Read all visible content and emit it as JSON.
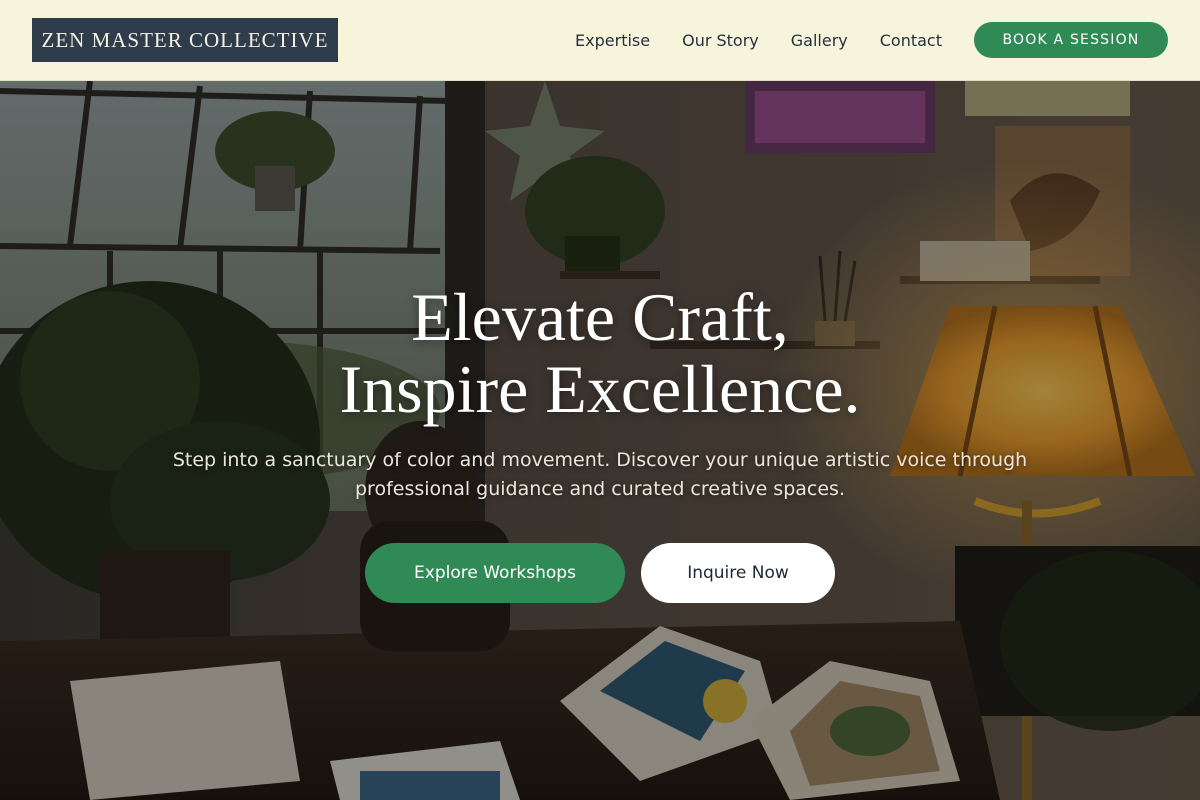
{
  "brand": {
    "name": "ZEN MASTER COLLECTIVE"
  },
  "nav": {
    "items": [
      {
        "label": "Expertise"
      },
      {
        "label": "Our Story"
      },
      {
        "label": "Gallery"
      },
      {
        "label": "Contact"
      }
    ],
    "cta_label": "BOOK A SESSION"
  },
  "hero": {
    "title_line1": "Elevate Craft,",
    "title_line2": "Inspire Excellence.",
    "subtitle": "Step into a sanctuary of color and movement. Discover your unique artistic voice through professional guidance and curated creative spaces.",
    "primary_button": "Explore Workshops",
    "secondary_button": "Inquire Now"
  },
  "colors": {
    "header_bg": "#f6f4db",
    "logo_bg": "#2f3c4c",
    "accent_green": "#2f8a55",
    "button_white": "#ffffff"
  }
}
